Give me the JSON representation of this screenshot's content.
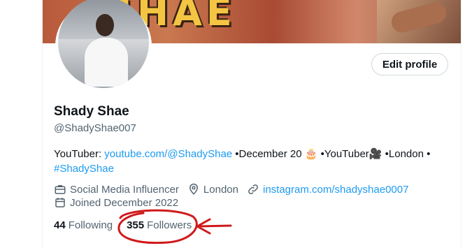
{
  "banner": {
    "text": "SHAE"
  },
  "profile": {
    "name": "Shady Shae",
    "handle": "@ShadyShae007",
    "edit_label": "Edit profile"
  },
  "bio": {
    "prefix": "YouTuber: ",
    "youtube_link": "youtube.com/@ShadyShae",
    "sep1": " •December 20 🎂 •YouTuber🎥  •London •",
    "hashtag": "#ShadyShae"
  },
  "meta": {
    "category": "Social Media Influencer",
    "location": "London",
    "website": "instagram.com/shadyshae0007",
    "joined": "Joined December 2022"
  },
  "follow": {
    "following_count": "44",
    "following_label": "Following",
    "followers_count": "355",
    "followers_label": "Followers"
  },
  "colors": {
    "accent": "#1d9bf0",
    "annotation": "#d0191b",
    "muted": "#536471"
  }
}
